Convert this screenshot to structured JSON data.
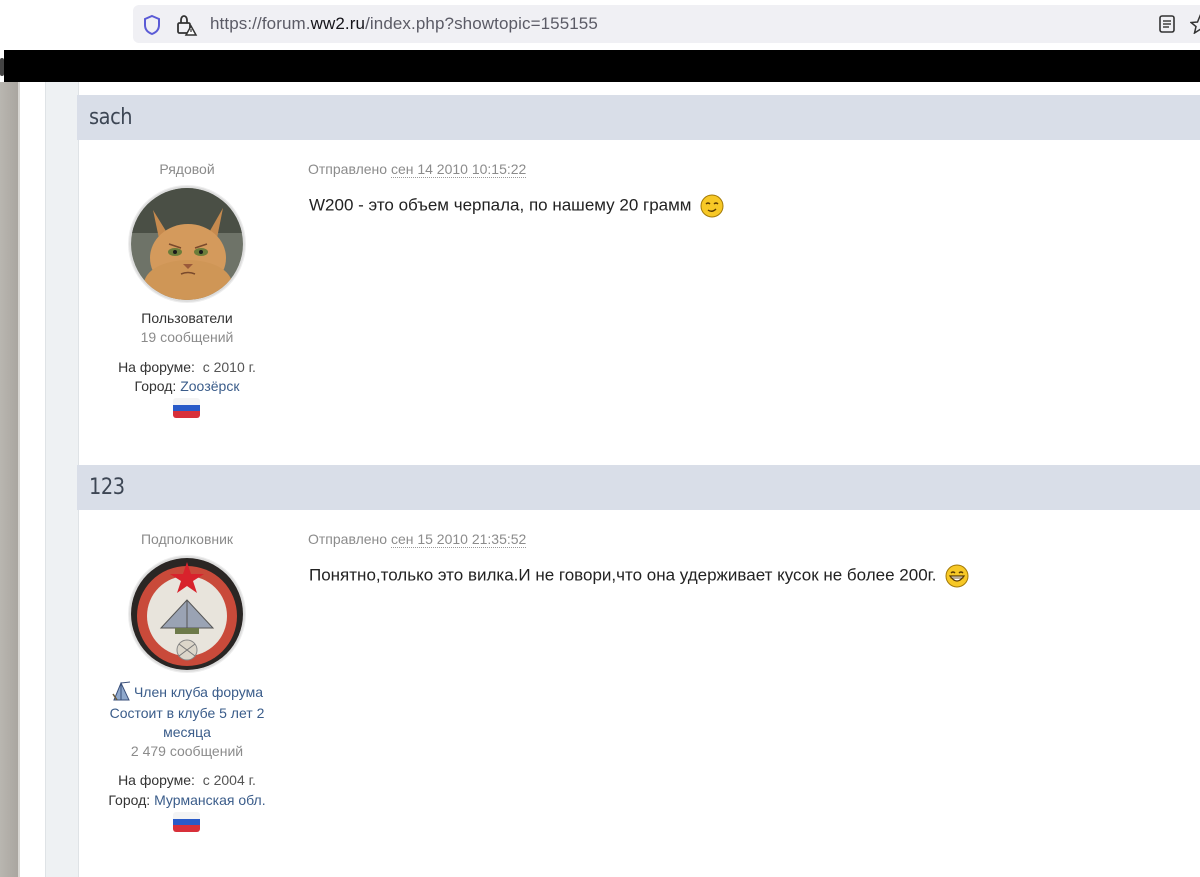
{
  "browser": {
    "url_prefix": "https://forum.",
    "url_domain": "ww2.ru",
    "url_suffix": "/index.php?showtopic=155155"
  },
  "posts": [
    {
      "author": "sach",
      "rank": "Рядовой",
      "group": "Пользователи",
      "post_count": "19 сообщений",
      "on_forum_label": "На форуме:",
      "on_forum_value": "с 2010 г.",
      "city_label": "Город:",
      "city_value": "Zooзёрск",
      "sent_label": "Отправлено",
      "date": "сен 14 2010 10:15:22",
      "text": "W200 - это объем черпала, по нашему 20 грамм",
      "smiley": "smirk-smiley-icon"
    },
    {
      "author": "123",
      "rank": "Подполковник",
      "club_label": "Член клуба форума",
      "club_duration": "Состоит в клубе 5 лет 2 месяца",
      "post_count": "2 479 сообщений",
      "on_forum_label": "На форуме:",
      "on_forum_value": "с 2004 г.",
      "city_label": "Город:",
      "city_value": "Мурманская обл.",
      "sent_label": "Отправлено",
      "date": "сен 15 2010 21:35:52",
      "text": "Понятно,только это вилка.И не говори,что она удерживает кусок не более 200г.",
      "smiley": "grin-smiley-icon"
    }
  ],
  "colors": {
    "header_bg": "#d9dee8",
    "link_blue": "#3a5c8a",
    "muted_gray": "#8b8b8b"
  }
}
